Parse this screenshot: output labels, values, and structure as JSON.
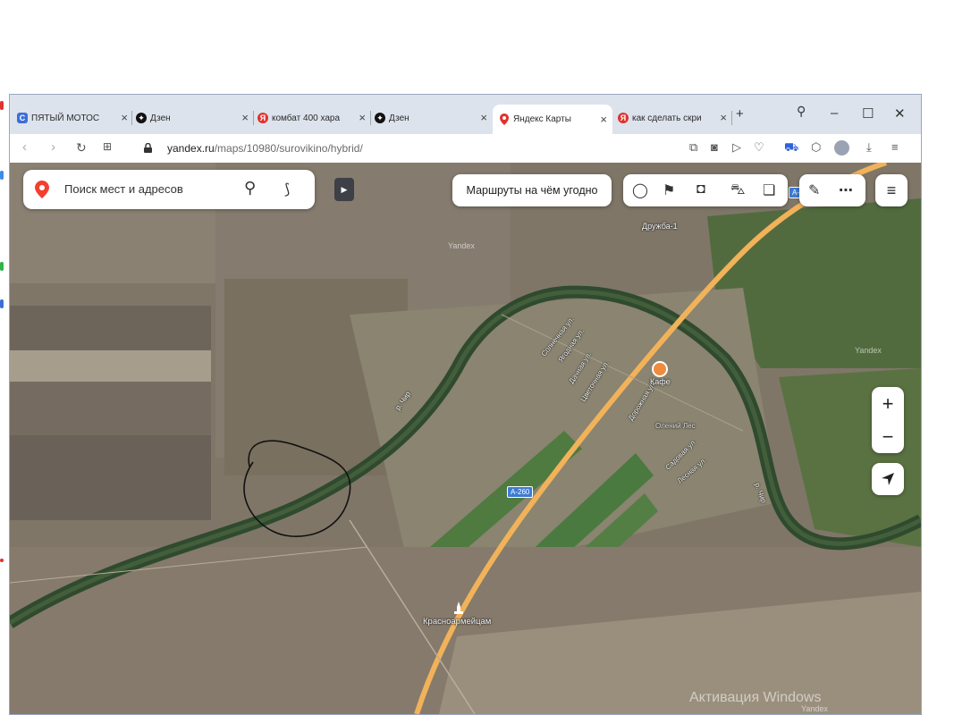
{
  "tabs": [
    {
      "label": "ПЯТЫЙ МОТОС",
      "favicon": "C",
      "color": "#3b6fd8"
    },
    {
      "label": "Дзен",
      "favicon": "",
      "color": "#111111"
    },
    {
      "label": "комбат 400 хара",
      "favicon": "Я",
      "color": "#e0322e"
    },
    {
      "label": "Дзен",
      "favicon": "",
      "color": "#111111"
    },
    {
      "label": "Яндекс Карты",
      "favicon": "",
      "color": "#e0322e"
    },
    {
      "label": "как сделать скри",
      "favicon": "Я",
      "color": "#e0322e"
    }
  ],
  "address": {
    "host": "yandex.ru",
    "path": "/maps/10980/surovikino/hybrid/"
  },
  "search": {
    "placeholder": "Поиск мест и адресов"
  },
  "routes_label": "Маршруты на чём угодно",
  "map": {
    "places": {
      "druzhba": "Дружба-1",
      "cafe": "Кафе",
      "krasnoarmeitsam": "Красноармейцам",
      "village": "Олений Лес",
      "river_1": "р. Чир",
      "river_2": "р. Чир",
      "yandex_1": "Yandex",
      "yandex_2": "Yandex",
      "yandex_3": "Yandex"
    },
    "streets": [
      "Солнечная ул.",
      "Ягодная ул.",
      "Дачная ул.",
      "Цветочная ул.",
      "Дорожная ул.",
      "Садовая ул.",
      "Лесная ул."
    ],
    "road_badge": "А-260",
    "road_badge_2": "А-2"
  },
  "watermark": "Активация Windows"
}
